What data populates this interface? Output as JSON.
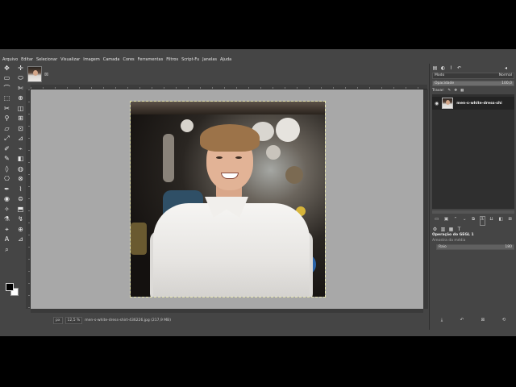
{
  "menu": [
    "Arquivo",
    "Editar",
    "Selecionar",
    "Visualizar",
    "Imagem",
    "Camada",
    "Cores",
    "Ferramentas",
    "Filtros",
    "Script-Fu",
    "Janelas",
    "Ajuda"
  ],
  "image_tab": {
    "close_glyph": "⊠"
  },
  "tools": [
    "✥",
    "✛",
    "▭",
    "⬭",
    "⌒",
    "✄",
    "⬚",
    "⊕",
    "✂",
    "◫",
    "⚲",
    "⊞",
    "▱",
    "⊡",
    "⤢",
    "⊿",
    "✐",
    "⌁",
    "✎",
    "◧",
    "◊",
    "◍",
    "⎔",
    "⊗",
    "✒",
    "⌇",
    "◉",
    "⊜",
    "✧",
    "⬒",
    "⚗",
    "↯",
    "⌖",
    "⊕",
    "A",
    "⊿",
    "⌕"
  ],
  "colors": {
    "fg": "#000000",
    "bg": "#ffffff"
  },
  "statusbar": {
    "unit": "px",
    "zoom": "12,5 %",
    "info": "men-s-white-dress-shirt-436226.jpg (217,9 MB)"
  },
  "dock": {
    "mode_label": "Modo",
    "mode_value": "Normal",
    "opacity_label": "Opacidade",
    "opacity_value": "100,0",
    "lock_label": "Travar:",
    "layer_name": "men-s-white-dress-shi",
    "gegl_title": "Operação do GEGL 1",
    "amostra_label": "Amostra da média",
    "raio_label": "Raio",
    "raio_value": "180"
  }
}
